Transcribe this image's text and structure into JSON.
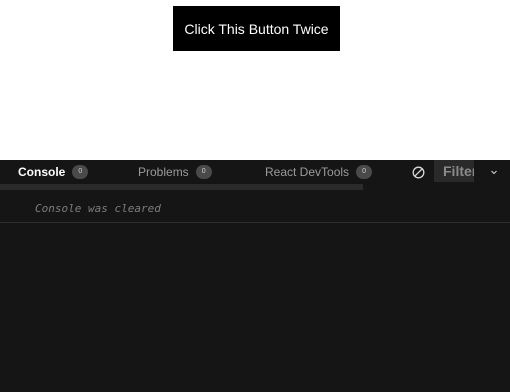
{
  "preview": {
    "button_label": "Click This Button Twice"
  },
  "devtools": {
    "tabs": [
      {
        "label": "Console",
        "count": "0",
        "active": true
      },
      {
        "label": "Problems",
        "count": "0",
        "active": false
      },
      {
        "label": "React DevTools",
        "count": "0",
        "active": false
      }
    ],
    "filter_placeholder": "Filter",
    "console_message": "Console was cleared",
    "icons": [
      "clear-console-icon",
      "chevron-down-icon"
    ]
  },
  "colors": {
    "panel_bg": "#151515",
    "button_bg": "#000000",
    "active_tab": "#ffffff",
    "inactive_tab": "#9b9b9b"
  }
}
